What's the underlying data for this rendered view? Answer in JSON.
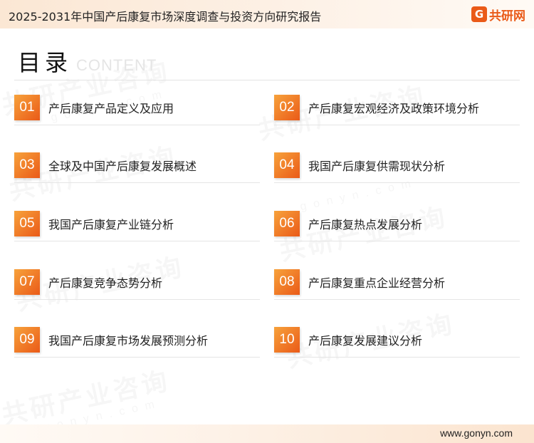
{
  "header": {
    "title": "2025-2031年中国产后康复市场深度调查与投资方向研究报告",
    "logo_mark": "G",
    "logo_text": "共研网"
  },
  "toc": {
    "title": "目录",
    "subtitle": "CONTENT",
    "items": [
      {
        "num": "01",
        "label": "产后康复产品定义及应用"
      },
      {
        "num": "02",
        "label": "产后康复宏观经济及政策环境分析"
      },
      {
        "num": "03",
        "label": "全球及中国产后康复发展概述"
      },
      {
        "num": "04",
        "label": "我国产后康复供需现状分析"
      },
      {
        "num": "05",
        "label": "我国产后康复产业链分析"
      },
      {
        "num": "06",
        "label": "产后康复热点发展分析"
      },
      {
        "num": "07",
        "label": "产后康复竞争态势分析"
      },
      {
        "num": "08",
        "label": "产后康复重点企业经营分析"
      },
      {
        "num": "09",
        "label": "我国产后康复市场发展预测分析"
      },
      {
        "num": "10",
        "label": "产后康复发展建议分析"
      }
    ]
  },
  "watermark": {
    "text": "共研产业咨询",
    "sub": "gonyn.com"
  },
  "footer": {
    "url": "www.gonyn.com"
  },
  "colors": {
    "accent": "#ea5a18",
    "accent_light": "#f7a23b"
  }
}
